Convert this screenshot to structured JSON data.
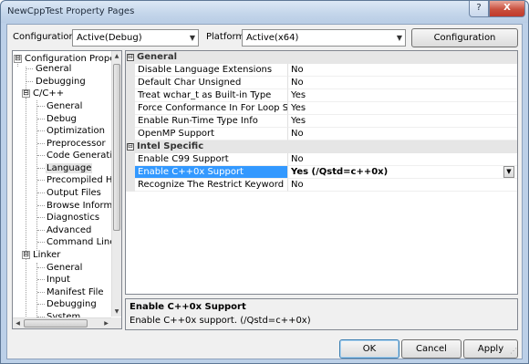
{
  "window": {
    "title": "NewCppTest Property Pages",
    "help_glyph": "?",
    "close_glyph": "X"
  },
  "toolbar": {
    "configuration_label": "Configuration:",
    "configuration_value": "Active(Debug)",
    "platform_label": "Platform:",
    "platform_value": "Active(x64)",
    "config_manager_label": "Configuration Manager..."
  },
  "tree": {
    "items": [
      {
        "label": "Configuration Proper",
        "glyph": "⊟"
      },
      {
        "label": "General"
      },
      {
        "label": "Debugging"
      },
      {
        "label": "C/C++",
        "glyph": "⊟"
      },
      {
        "label": "General"
      },
      {
        "label": "Debug"
      },
      {
        "label": "Optimization"
      },
      {
        "label": "Preprocessor"
      },
      {
        "label": "Code Generatio"
      },
      {
        "label": "Language"
      },
      {
        "label": "Precompiled H"
      },
      {
        "label": "Output Files"
      },
      {
        "label": "Browse Informa"
      },
      {
        "label": "Diagnostics"
      },
      {
        "label": "Advanced"
      },
      {
        "label": "Command Line"
      },
      {
        "label": "Linker",
        "glyph": "⊟"
      },
      {
        "label": "General"
      },
      {
        "label": "Input"
      },
      {
        "label": "Manifest File"
      },
      {
        "label": "Debugging"
      },
      {
        "label": "System"
      }
    ]
  },
  "grid": {
    "categories": [
      {
        "glyph": "⊟",
        "label": "General"
      },
      {
        "glyph": "⊟",
        "label": "Intel Specific"
      }
    ],
    "rows": [
      {
        "name": "Disable Language Extensions",
        "value": "No"
      },
      {
        "name": "Default Char Unsigned",
        "value": "No"
      },
      {
        "name": "Treat wchar_t as Built-in Type",
        "value": "Yes"
      },
      {
        "name": "Force Conformance In For Loop Scope",
        "value": "Yes"
      },
      {
        "name": "Enable Run-Time Type Info",
        "value": "Yes"
      },
      {
        "name": "OpenMP Support",
        "value": "No"
      },
      {
        "name": "Enable C99 Support",
        "value": "No"
      },
      {
        "name": "Enable C++0x Support",
        "value": "Yes (/Qstd=c++0x)"
      },
      {
        "name": "Recognize The Restrict Keyword",
        "value": "No"
      }
    ]
  },
  "description": {
    "title": "Enable C++0x Support",
    "text": "Enable C++0x support.   (/Qstd=c++0x)"
  },
  "buttons": {
    "ok": "OK",
    "cancel": "Cancel",
    "apply": "Apply"
  }
}
